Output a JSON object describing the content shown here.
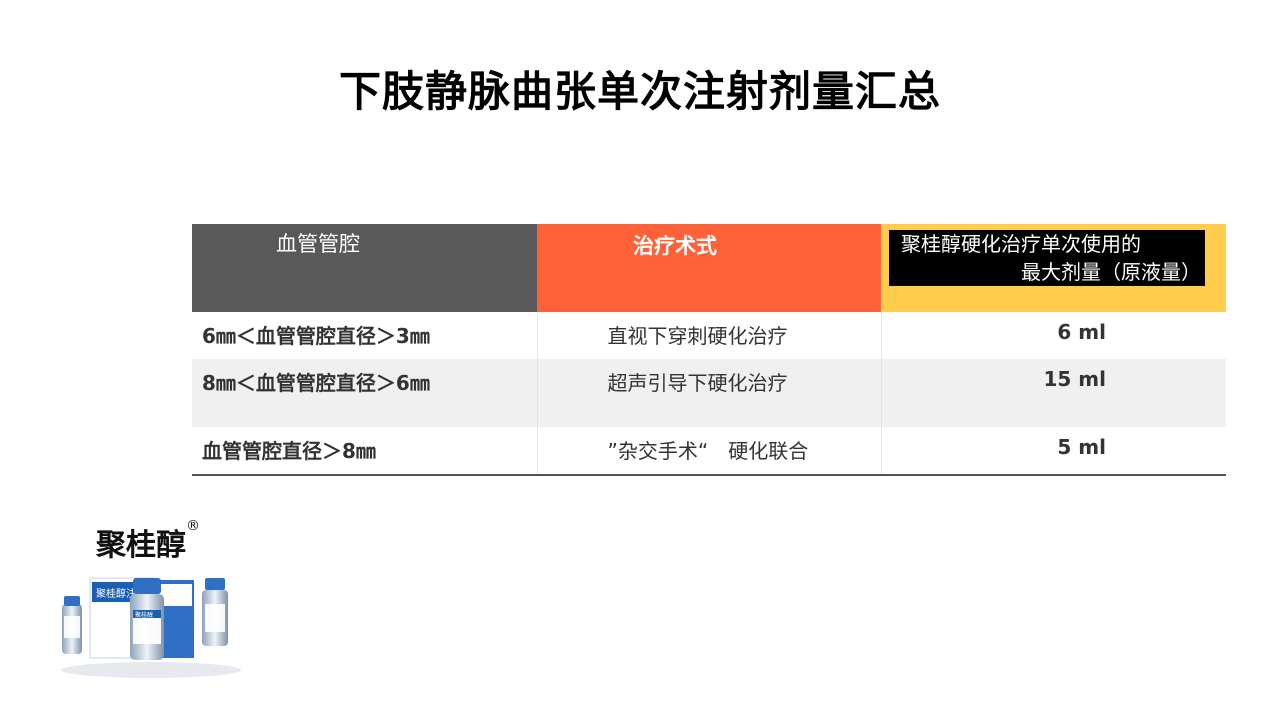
{
  "title": "下肢静脉曲张单次注射剂量汇总",
  "table": {
    "headers": {
      "col1": "血管管腔",
      "col2": "治疗术式",
      "col3_line1": "聚桂醇硬化治疗单次使用的",
      "col3_line2": "最大剂量（原液量）"
    },
    "rows": [
      {
        "lumen": "6㎜＜血管管腔直径＞3㎜",
        "method": "直视下穿刺硬化治疗",
        "dose": "6 ml"
      },
      {
        "lumen": "8㎜＜血管管腔直径＞6㎜",
        "method": "超声引导下硬化治疗",
        "dose": "15 ml"
      },
      {
        "lumen": "血管管腔直径＞8㎜",
        "method": "”杂交手术“　硬化联合",
        "dose": "5 ml"
      }
    ]
  },
  "brand": {
    "name": "聚桂醇",
    "mark": "®"
  },
  "product_image": {
    "box_label": "聚桂醇注射液",
    "vial_label": "聚桂醇"
  },
  "colors": {
    "header_gray": "#595959",
    "header_orange": "#ff6138",
    "header_yellow": "#ffcc4c"
  }
}
